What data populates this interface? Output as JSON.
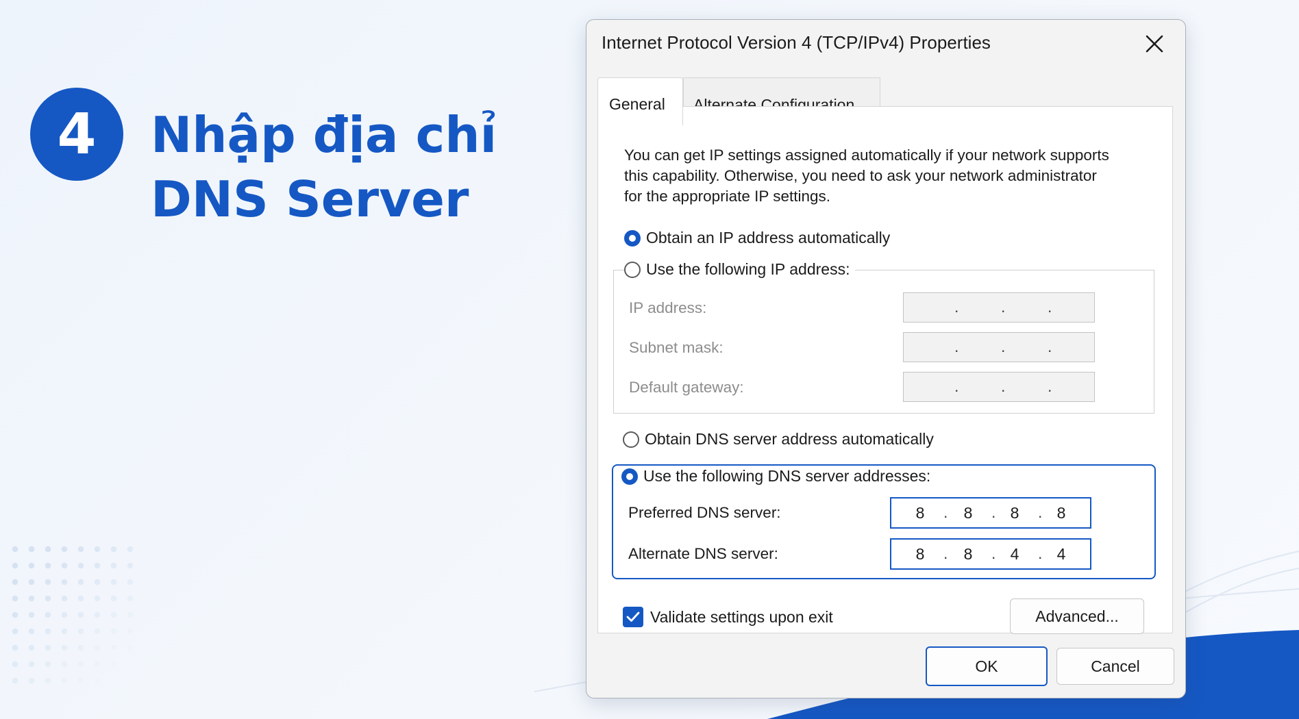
{
  "step": {
    "number": "4",
    "title_line1": "Nhập địa chỉ",
    "title_line2": "DNS Server"
  },
  "dialog": {
    "title": "Internet Protocol Version 4 (TCP/IPv4) Properties",
    "tabs": [
      {
        "label": "General",
        "active": true
      },
      {
        "label": "Alternate Configuration",
        "active": false
      }
    ],
    "description": [
      "You can get IP settings assigned automatically if your network supports",
      "this capability. Otherwise, you need to ask your network administrator",
      "for the appropriate IP settings."
    ],
    "ip_options": {
      "auto_label": "Obtain an IP address automatically",
      "auto_selected": true,
      "manual_label": "Use the following IP address:",
      "manual_selected": false
    },
    "ip_fields": [
      {
        "label": "IP address:",
        "octets": [
          "",
          "",
          "",
          ""
        ]
      },
      {
        "label": "Subnet mask:",
        "octets": [
          "",
          "",
          "",
          ""
        ]
      },
      {
        "label": "Default gateway:",
        "octets": [
          "",
          "",
          "",
          ""
        ]
      }
    ],
    "dns_options": {
      "auto_label": "Obtain DNS server address automatically",
      "auto_selected": false,
      "manual_label": "Use the following DNS server addresses:",
      "manual_selected": true
    },
    "dns_fields": [
      {
        "label": "Preferred DNS server:",
        "octets": [
          "8",
          "8",
          "8",
          "8"
        ]
      },
      {
        "label": "Alternate DNS server:",
        "octets": [
          "8",
          "8",
          "4",
          "4"
        ]
      }
    ],
    "validate": {
      "label": "Validate settings upon exit",
      "checked": true
    },
    "buttons": {
      "advanced": "Advanced...",
      "ok": "OK",
      "cancel": "Cancel"
    },
    "colors": {
      "accent": "#1558c4",
      "heading": "#1558c4"
    }
  }
}
